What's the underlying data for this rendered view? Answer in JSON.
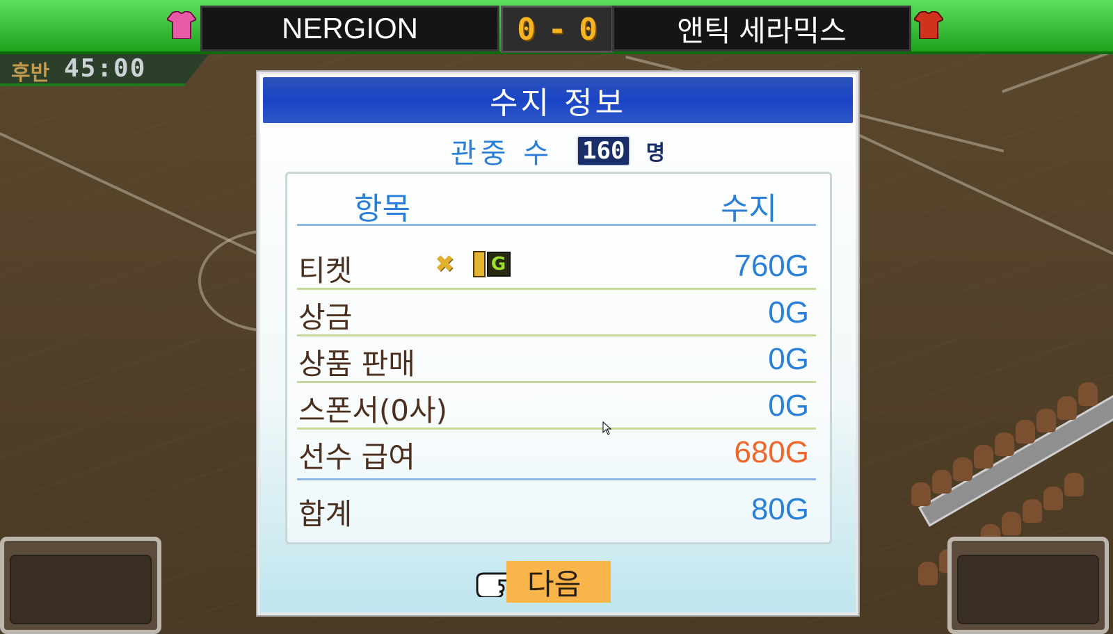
{
  "scoreboard": {
    "home_team": "NERGION",
    "away_team": "앤틱 세라믹스",
    "home_score": "0",
    "away_score": "0",
    "home_color": "#e85aa8",
    "away_color": "#d0321e",
    "half": "후반",
    "clock": "45:00"
  },
  "dialog": {
    "title": "수지 정보",
    "attendance_label": "관중 수",
    "attendance_value": "160",
    "attendance_unit": "명",
    "col_item": "항목",
    "col_balance": "수지",
    "rows": [
      {
        "name": "티켓",
        "value": "760G",
        "type": "income"
      },
      {
        "name": "상금",
        "value": "0G",
        "type": "income"
      },
      {
        "name": "상품 판매",
        "value": "0G",
        "type": "income"
      },
      {
        "name": "스폰서(0사)",
        "value": "0G",
        "type": "income"
      },
      {
        "name": "선수 급여",
        "value": "680G",
        "type": "expense"
      }
    ],
    "total_name": "합계",
    "total_value": "80G",
    "ticket_multiplier_icon": "x-icon",
    "ticket_price_digit": "1",
    "ticket_price_currency": "G",
    "next_label": "다음",
    "pointer_icon": "pointing-hand-icon"
  }
}
